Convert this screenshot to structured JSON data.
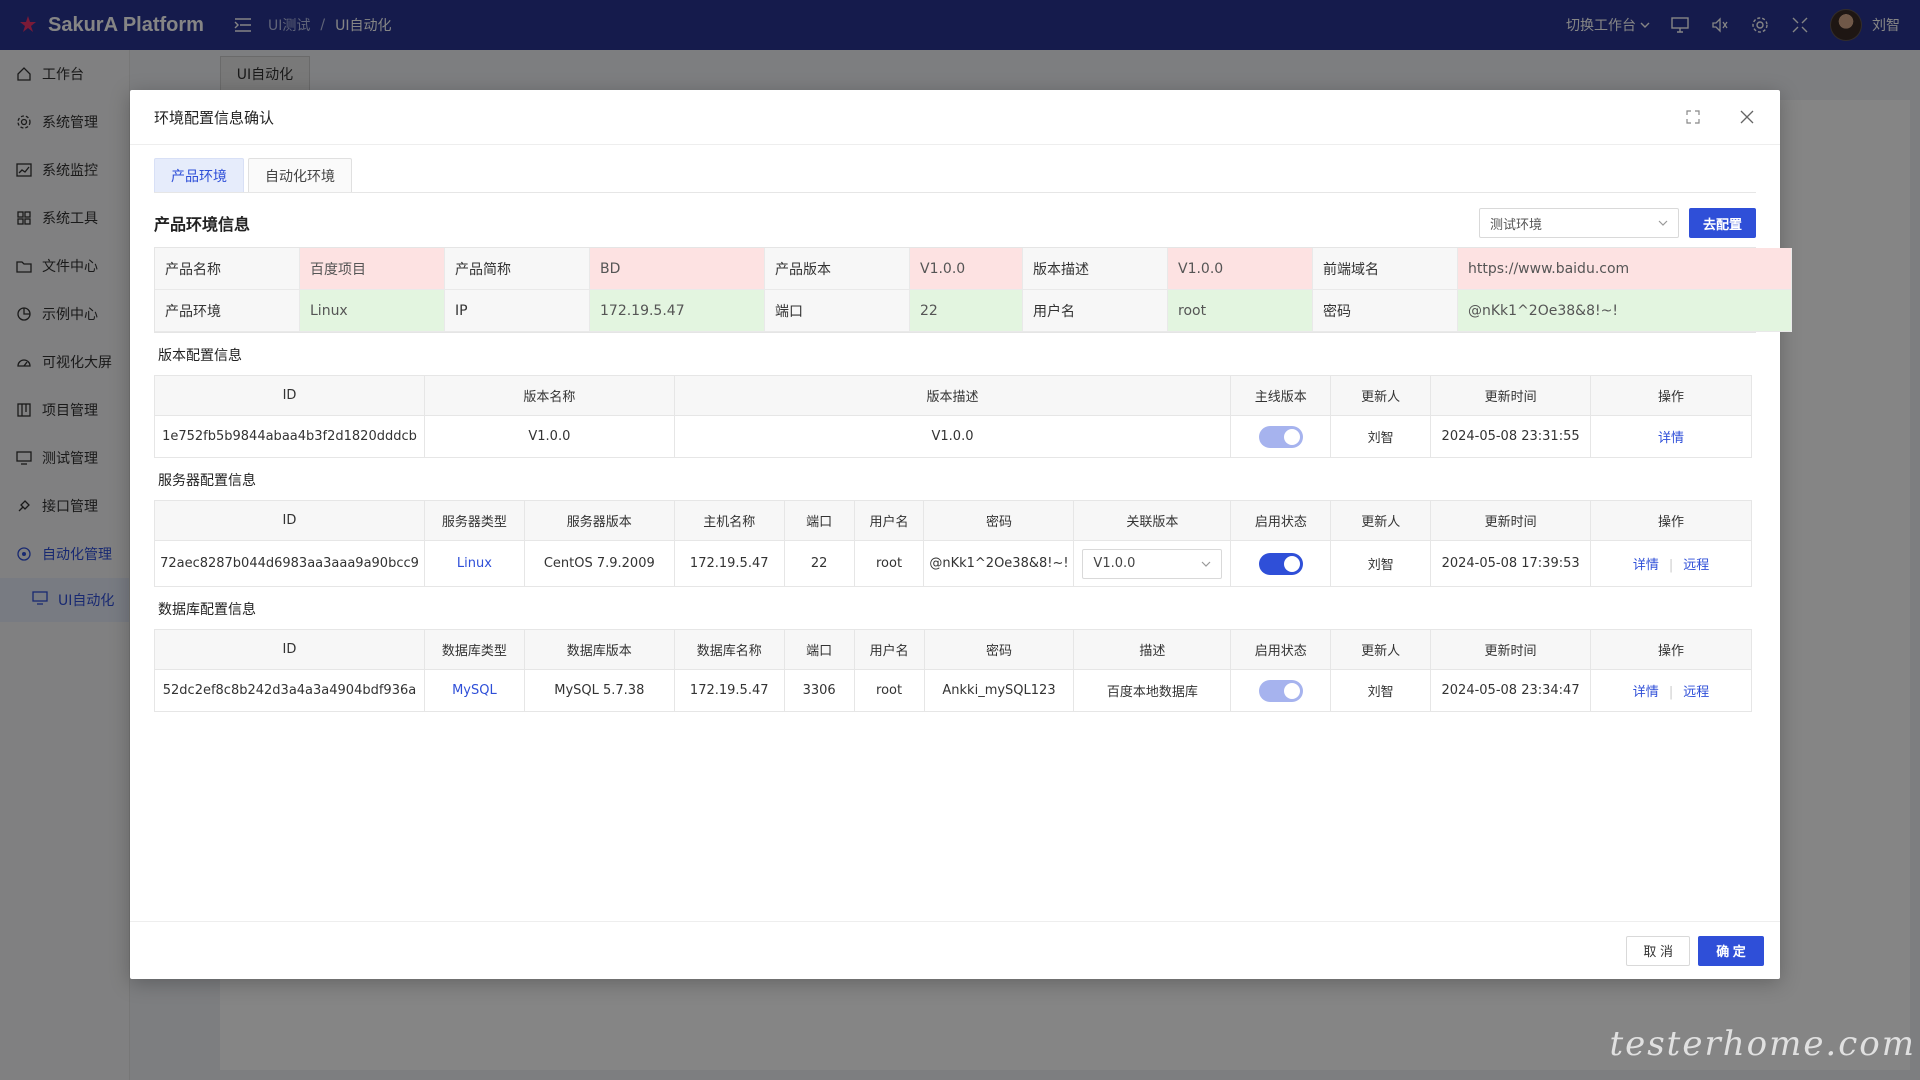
{
  "app": {
    "name": "SakurA Platform"
  },
  "breadcrumb": {
    "parent": "UI测试",
    "separator": "/",
    "current": "UI自动化"
  },
  "header": {
    "workspace_label": "切换工作台",
    "user_name": "刘智"
  },
  "sidebar": {
    "items": [
      {
        "label": "工作台",
        "icon": "home-icon"
      },
      {
        "label": "系统管理",
        "icon": "gear-icon"
      },
      {
        "label": "系统监控",
        "icon": "chart-icon"
      },
      {
        "label": "系统工具",
        "icon": "grid-icon"
      },
      {
        "label": "文件中心",
        "icon": "folder-icon"
      },
      {
        "label": "示例中心",
        "icon": "pie-icon"
      },
      {
        "label": "可视化大屏",
        "icon": "dashboard-icon"
      },
      {
        "label": "项目管理",
        "icon": "board-icon"
      },
      {
        "label": "测试管理",
        "icon": "monitor-icon"
      },
      {
        "label": "接口管理",
        "icon": "api-icon"
      },
      {
        "label": "自动化管理",
        "icon": "robot-icon"
      }
    ],
    "sub_item": {
      "label": "UI自动化",
      "icon": "screen-icon"
    }
  },
  "bg_tab": {
    "label": "UI自动化"
  },
  "dialog": {
    "title": "环境配置信息确认",
    "tabs": [
      {
        "label": "产品环境"
      },
      {
        "label": "自动化环境"
      }
    ],
    "product_section": {
      "title": "产品环境信息",
      "env_select_value": "测试环境",
      "config_button": "去配置",
      "row1": [
        {
          "label": "产品名称",
          "value": "百度项目"
        },
        {
          "label": "产品简称",
          "value": "BD"
        },
        {
          "label": "产品版本",
          "value": "V1.0.0"
        },
        {
          "label": "版本描述",
          "value": "V1.0.0"
        },
        {
          "label": "前端域名",
          "value": "https://www.baidu.com"
        }
      ],
      "row2": [
        {
          "label": "产品环境",
          "value": "Linux"
        },
        {
          "label": "IP",
          "value": "172.19.5.47"
        },
        {
          "label": "端口",
          "value": "22"
        },
        {
          "label": "用户名",
          "value": "root"
        },
        {
          "label": "密码",
          "value": "@nKk1^2Oe38&8!~!"
        }
      ]
    },
    "version_section": {
      "title": "版本配置信息",
      "headers": [
        "ID",
        "版本名称",
        "版本描述",
        "主线版本",
        "更新人",
        "更新时间",
        "操作"
      ],
      "row": {
        "id": "1e752fb5b9844abaa4b3f2d1820dddcb",
        "name": "V1.0.0",
        "desc": "V1.0.0",
        "mainline": true,
        "updater": "刘智",
        "updated": "2024-05-08 23:31:55",
        "action": "详情"
      }
    },
    "server_section": {
      "title": "服务器配置信息",
      "headers": [
        "ID",
        "服务器类型",
        "服务器版本",
        "主机名称",
        "端口",
        "用户名",
        "密码",
        "关联版本",
        "启用状态",
        "更新人",
        "更新时间",
        "操作"
      ],
      "row": {
        "id": "72aec8287b044d6983aa3aaa9a90bcc9",
        "type": "Linux",
        "version": "CentOS 7.9.2009",
        "host": "172.19.5.47",
        "port": "22",
        "user": "root",
        "password": "@nKk1^2Oe38&8!~!",
        "linked_version": "V1.0.0",
        "enabled": true,
        "updater": "刘智",
        "updated": "2024-05-08 17:39:53",
        "action1": "详情",
        "action2": "远程"
      }
    },
    "db_section": {
      "title": "数据库配置信息",
      "headers": [
        "ID",
        "数据库类型",
        "数据库版本",
        "数据库名称",
        "端口",
        "用户名",
        "密码",
        "描述",
        "启用状态",
        "更新人",
        "更新时间",
        "操作"
      ],
      "row": {
        "id": "52dc2ef8c8b242d3a4a3a4904bdf936a",
        "type": "MySQL",
        "version": "MySQL 5.7.38",
        "name": "172.19.5.47",
        "port": "3306",
        "user": "root",
        "password": "Ankki_mySQL123",
        "desc": "百度本地数据库",
        "enabled": true,
        "updater": "刘智",
        "updated": "2024-05-08 23:34:47",
        "action1": "详情",
        "action2": "远程"
      }
    },
    "footer": {
      "cancel": "取 消",
      "ok": "确 定"
    }
  },
  "watermark": "testerhome.com",
  "colors": {
    "primary": "#2f4fd8",
    "topbar": "#2a3593",
    "switch_on": "#2f4fd8",
    "switch_light": "#a6b3ee"
  }
}
